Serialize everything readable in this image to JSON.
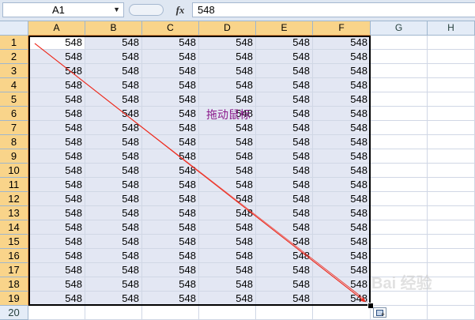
{
  "formula_bar": {
    "name_box": "A1",
    "fx_label": "fx",
    "formula_value": "548"
  },
  "columns": [
    "A",
    "B",
    "C",
    "D",
    "E",
    "F",
    "G",
    "H"
  ],
  "selected_columns": [
    "A",
    "B",
    "C",
    "D",
    "E",
    "F"
  ],
  "rows": [
    "1",
    "2",
    "3",
    "4",
    "5",
    "6",
    "7",
    "8",
    "9",
    "10",
    "11",
    "12",
    "13",
    "14",
    "15",
    "16",
    "17",
    "18",
    "19",
    "20"
  ],
  "selected_rows": 19,
  "cell_value": "548",
  "annotation": {
    "label": "拖动鼠标",
    "arrow_color": "#ee2a1d",
    "label_color": "#8b1a8b"
  },
  "watermark": "Bai 经验",
  "colors": {
    "header_bg": "#e4ecf7",
    "selected_header_bg": "#f9d48a",
    "selection_fill": "#e3e7f3"
  }
}
